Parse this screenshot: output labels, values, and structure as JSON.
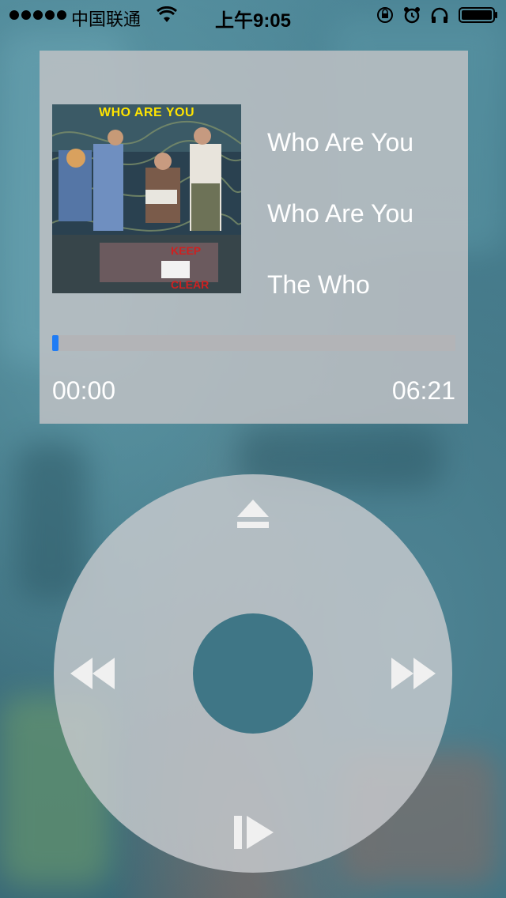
{
  "status_bar": {
    "carrier": "中国联通",
    "time": "上午9:05",
    "icons": [
      "signal-dots-icon",
      "wifi-icon",
      "rotation-lock-icon",
      "alarm-icon",
      "headphones-icon",
      "battery-icon"
    ]
  },
  "album": {
    "cover_title": "WHO ARE YOU",
    "cover_icon": "album-cover-art"
  },
  "track": {
    "title": "Who Are You",
    "album": "Who Are You",
    "artist": "The Who"
  },
  "progress": {
    "current": "00:00",
    "total": "06:21",
    "fraction": 0.0,
    "fill_color": "#1f7cf5"
  },
  "wheel": {
    "top_icon": "eject-icon",
    "left_icon": "rewind-icon",
    "right_icon": "fast-forward-icon",
    "bottom_icon": "play-pause-icon"
  }
}
